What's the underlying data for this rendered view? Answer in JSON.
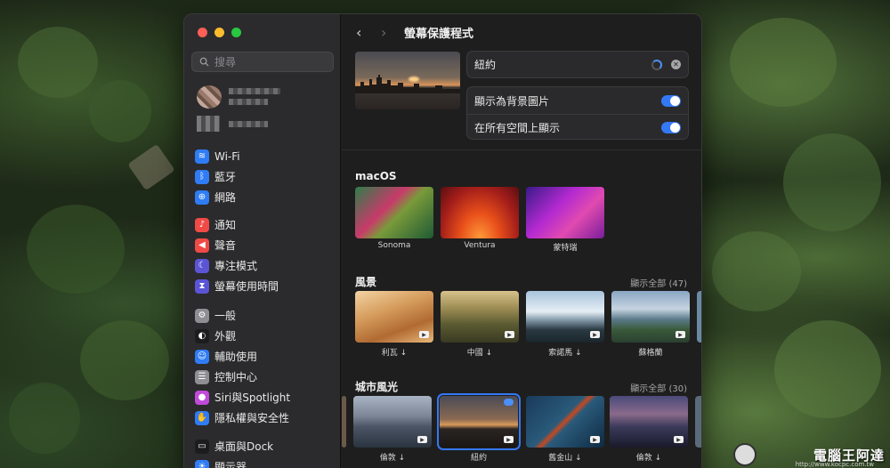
{
  "sidebar": {
    "search_placeholder": "搜尋",
    "groups": [
      {
        "items": [
          {
            "label": "Wi-Fi",
            "icon": "wifi-icon",
            "color": "#2f7cf6"
          },
          {
            "label": "藍牙",
            "icon": "bluetooth-icon",
            "color": "#2f7cf6"
          },
          {
            "label": "網路",
            "icon": "globe-icon",
            "color": "#2f7cf6"
          }
        ]
      },
      {
        "items": [
          {
            "label": "通知",
            "icon": "bell-icon",
            "color": "#f04a46"
          },
          {
            "label": "聲音",
            "icon": "speaker-icon",
            "color": "#f04a46"
          },
          {
            "label": "專注模式",
            "icon": "moon-icon",
            "color": "#5b55d6"
          },
          {
            "label": "螢幕使用時間",
            "icon": "hourglass-icon",
            "color": "#5b55d6"
          }
        ]
      },
      {
        "items": [
          {
            "label": "一般",
            "icon": "gear-icon",
            "color": "#8e8e93"
          },
          {
            "label": "外觀",
            "icon": "appearance-icon",
            "color": "#1c1c1e"
          },
          {
            "label": "輔助使用",
            "icon": "accessibility-icon",
            "color": "#2f7cf6"
          },
          {
            "label": "控制中心",
            "icon": "control-center-icon",
            "color": "#8e8e93"
          },
          {
            "label": "Siri與Spotlight",
            "icon": "siri-icon",
            "color": "#c04ad9"
          },
          {
            "label": "隱私權與安全性",
            "icon": "hand-icon",
            "color": "#2f7cf6"
          }
        ]
      },
      {
        "items": [
          {
            "label": "桌面與Dock",
            "icon": "dock-icon",
            "color": "#1c1c1e"
          },
          {
            "label": "顯示器",
            "icon": "display-icon",
            "color": "#2f7cf6"
          }
        ]
      }
    ]
  },
  "header": {
    "back_glyph": "‹",
    "forward_glyph": "›",
    "title": "螢幕保護程式"
  },
  "current": {
    "name": "紐約",
    "toggle1_label": "顯示為背景圖片",
    "toggle1_on": true,
    "toggle2_label": "在所有空間上顯示",
    "toggle2_on": true
  },
  "sections": {
    "macos": {
      "title": "macOS",
      "items": [
        {
          "label": "Sonoma"
        },
        {
          "label": "Ventura"
        },
        {
          "label": "蒙特瑞"
        }
      ]
    },
    "landscape": {
      "title": "風景",
      "show_all": "顯示全部 (47)",
      "items": [
        {
          "label": "利瓦 ↓"
        },
        {
          "label": "中國 ↓"
        },
        {
          "label": "索諾馬 ↓"
        },
        {
          "label": "蘇格蘭"
        }
      ]
    },
    "city": {
      "title": "城市風光",
      "show_all": "顯示全部 (30)",
      "items": [
        {
          "label": "倫敦 ↓"
        },
        {
          "label": "紐約"
        },
        {
          "label": "舊金山 ↓"
        },
        {
          "label": "倫敦 ↓"
        }
      ]
    }
  },
  "watermark": {
    "text": "電腦王阿達",
    "url": "http://www.kocpc.com.tw"
  }
}
